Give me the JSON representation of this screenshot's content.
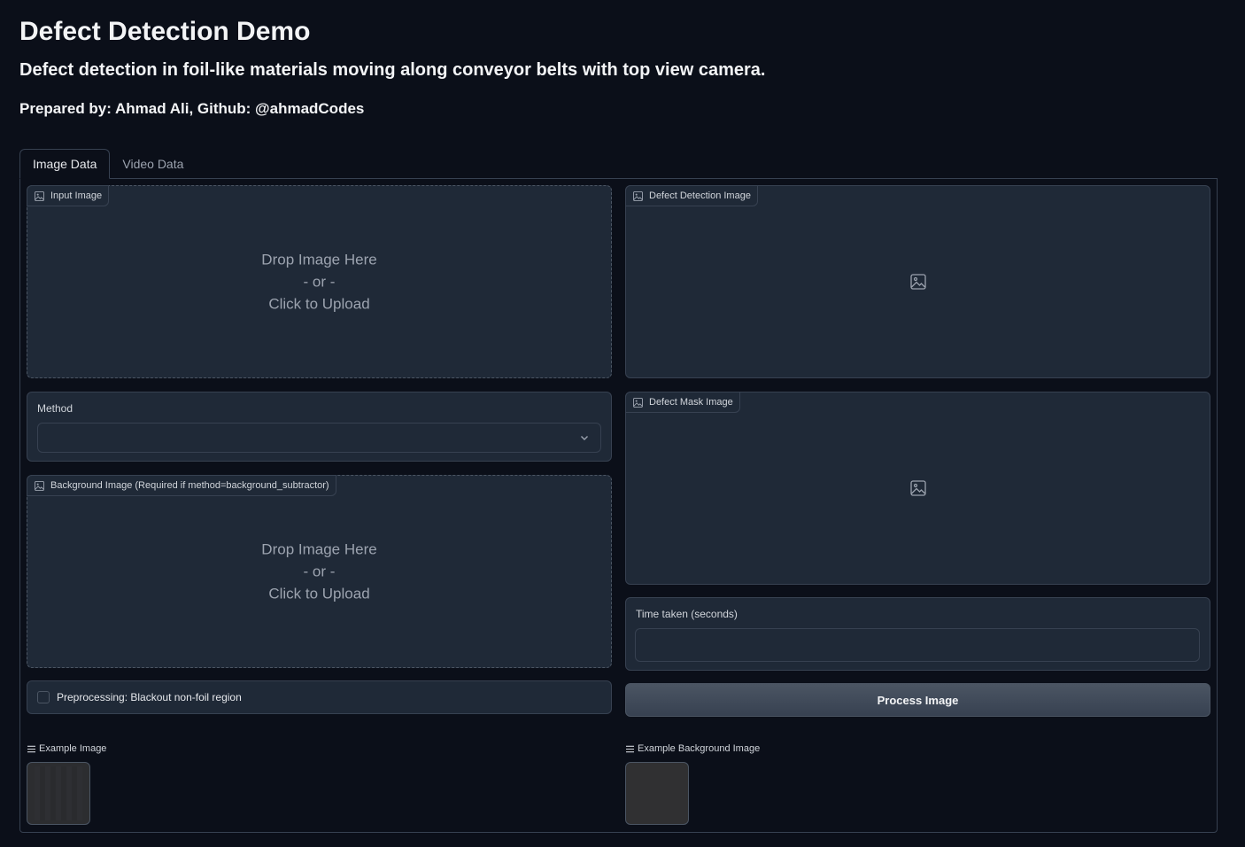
{
  "header": {
    "title": "Defect Detection Demo",
    "subtitle": "Defect detection in foil-like materials moving along conveyor belts with top view camera.",
    "author": "Prepared by: Ahmad Ali, Github: @ahmadCodes"
  },
  "tabs": [
    {
      "label": "Image Data",
      "active": true
    },
    {
      "label": "Video Data",
      "active": false
    }
  ],
  "left": {
    "input_image": {
      "label": "Input Image",
      "drop_text": "Drop Image Here",
      "or_text": "- or -",
      "click_text": "Click to Upload"
    },
    "method": {
      "label": "Method",
      "value": ""
    },
    "background_image": {
      "label": "Background Image (Required if method=background_subtractor)",
      "drop_text": "Drop Image Here",
      "or_text": "- or -",
      "click_text": "Click to Upload"
    },
    "preprocessing": {
      "label": "Preprocessing: Blackout non-foil region",
      "checked": false
    },
    "examples": {
      "label": "Example Image"
    }
  },
  "right": {
    "defect_detection_image": {
      "label": "Defect Detection Image"
    },
    "defect_mask_image": {
      "label": "Defect Mask Image"
    },
    "time_taken": {
      "label": "Time taken (seconds)",
      "value": ""
    },
    "process_button": {
      "label": "Process Image"
    },
    "examples": {
      "label": "Example Background Image"
    }
  },
  "icons": {
    "image": "image-icon",
    "chevron": "chevron-down-icon",
    "list": "list-icon"
  },
  "colors": {
    "background": "#0b0f19",
    "panel": "#1f2937",
    "border": "#374151",
    "button": "#4b5563"
  }
}
